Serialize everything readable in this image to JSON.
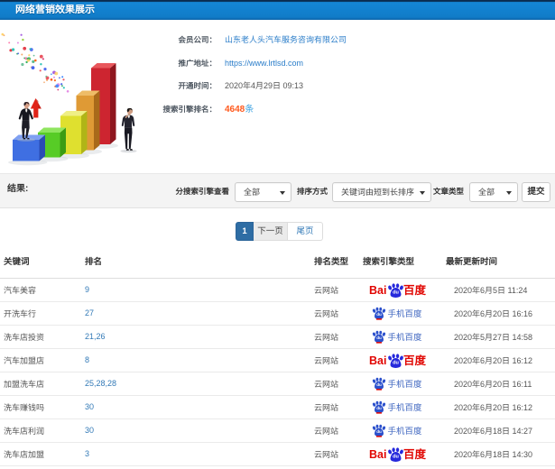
{
  "window": {
    "title": "网络营销效果展示"
  },
  "company_info": {
    "member_company": {
      "label": "会员公司：",
      "value": "山东老人头汽车服务咨询有限公司"
    },
    "promo_url": {
      "label": "推广地址：",
      "value": "https://www.lrtlsd.com"
    },
    "open_time": {
      "label": "开通时间：",
      "value": "2020年4月29日 09:13"
    },
    "engine_rank": {
      "label": "搜索引擎排名：",
      "value": "4648",
      "unit": "条"
    }
  },
  "filter_bar": {
    "result_label": "结果:",
    "engine_view": {
      "label": "分搜索引擎查看",
      "selected": "全部"
    },
    "sort_mode": {
      "label": "排序方式",
      "selected": "关键词由短到长排序"
    },
    "article_type": {
      "label": "文章类型",
      "selected": "全部"
    },
    "submit_label": "提交"
  },
  "pagination": {
    "current_page": "1",
    "next_label": "下一页",
    "last_label": "尾页"
  },
  "table": {
    "columns": {
      "keyword": "关键词",
      "rank": "排名",
      "rank_type": "排名类型",
      "engine_type": "搜索引擎类型",
      "updated": "最新更新时间"
    },
    "rows": [
      {
        "keyword": "汽车美容",
        "rank": "9",
        "rank_type": "云网站",
        "engine": "baidu",
        "updated": "2020年6月5日 11:24"
      },
      {
        "keyword": "开洗车行",
        "rank": "27",
        "rank_type": "云网站",
        "engine": "mobile-baidu",
        "updated": "2020年6月20日 16:16"
      },
      {
        "keyword": "洗车店投资",
        "rank": "21,26",
        "rank_type": "云网站",
        "engine": "mobile-baidu",
        "updated": "2020年5月27日 14:58"
      },
      {
        "keyword": "汽车加盟店",
        "rank": "8",
        "rank_type": "云网站",
        "engine": "baidu",
        "updated": "2020年6月20日 16:12"
      },
      {
        "keyword": "加盟洗车店",
        "rank": "25,28,28",
        "rank_type": "云网站",
        "engine": "mobile-baidu",
        "updated": "2020年6月20日 16:11"
      },
      {
        "keyword": "洗车赚钱吗",
        "rank": "30",
        "rank_type": "云网站",
        "engine": "mobile-baidu",
        "updated": "2020年6月20日 16:12"
      },
      {
        "keyword": "洗车店利润",
        "rank": "30",
        "rank_type": "云网站",
        "engine": "mobile-baidu",
        "updated": "2020年6月18日 14:27"
      },
      {
        "keyword": "洗车店加盟",
        "rank": "3",
        "rank_type": "云网站",
        "engine": "baidu",
        "updated": "2020年6月18日 14:30"
      }
    ]
  },
  "logos": {
    "baidu": {
      "bai": "Bai",
      "du": "du",
      "cn": "百度"
    },
    "mobile_baidu": {
      "du": "du",
      "label": "手机百度"
    }
  },
  "colors": {
    "header_blue": "#1180ce",
    "link_blue": "#2a7dc9",
    "rank_blue": "#337ab7",
    "highlight_orange": "#ff5a1e",
    "unit_blue": "#3aa0e0",
    "active_page_blue": "#2e6da4",
    "baidu_red": "#e10602",
    "baidu_paw_blue": "#2629dc",
    "mobile_baidu_blue": "#3f66c0"
  }
}
